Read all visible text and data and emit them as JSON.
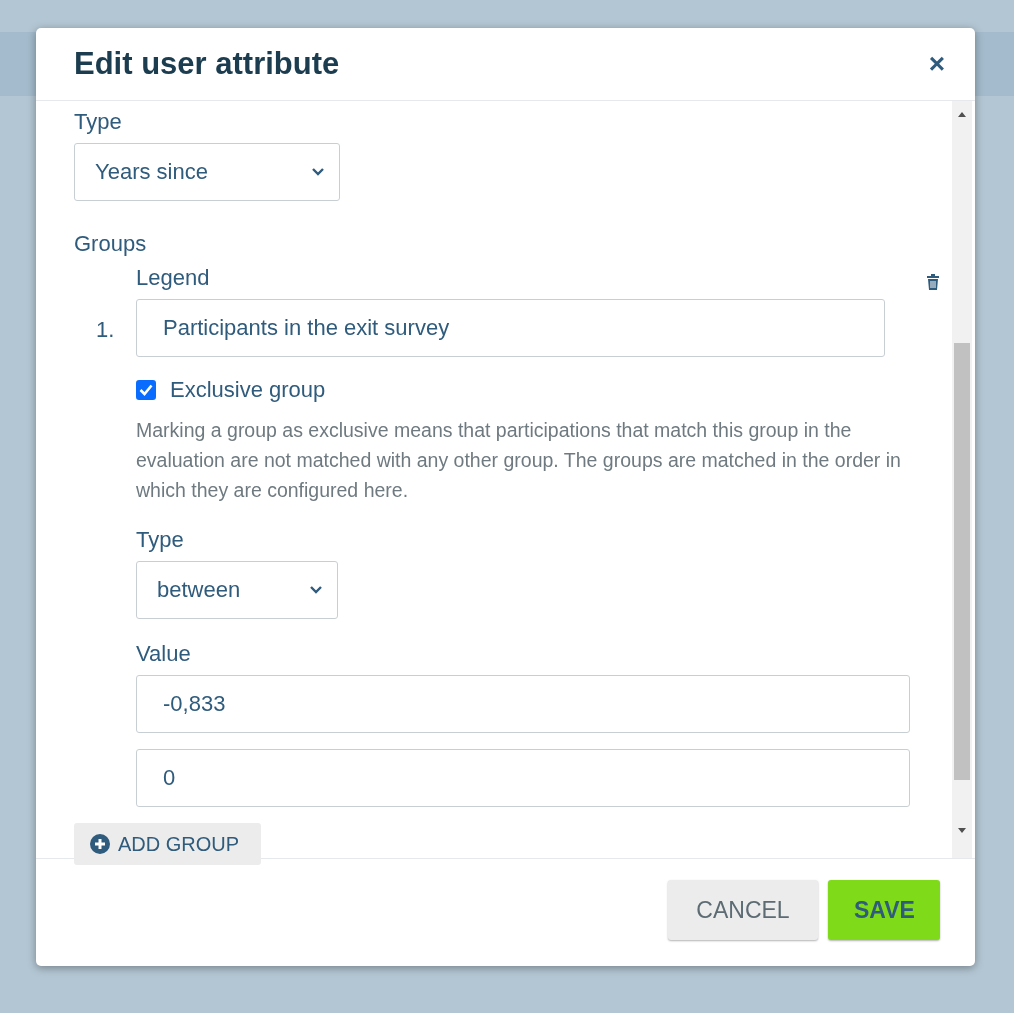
{
  "dialog": {
    "title": "Edit user attribute",
    "close": "×"
  },
  "type_field": {
    "label": "Type",
    "value": "Years since"
  },
  "groups": {
    "label": "Groups",
    "items": [
      {
        "number": "1.",
        "legend_label": "Legend",
        "legend": "Participants in the exit survey",
        "exclusive": {
          "label": "Exclusive group",
          "checked": true
        },
        "help": "Marking a group as exclusive means that participations that match this group in the evaluation are not matched with any other group. The groups are matched in the order in which they are configured here.",
        "type_label": "Type",
        "type_value": "between",
        "value_label": "Value",
        "values": [
          "-0,833",
          "0"
        ]
      }
    ]
  },
  "add_button": "ADD GROUP",
  "buttons": [
    {
      "label": "CANCEL",
      "kind": "secondary"
    },
    {
      "label": "SAVE",
      "kind": "primary"
    }
  ]
}
